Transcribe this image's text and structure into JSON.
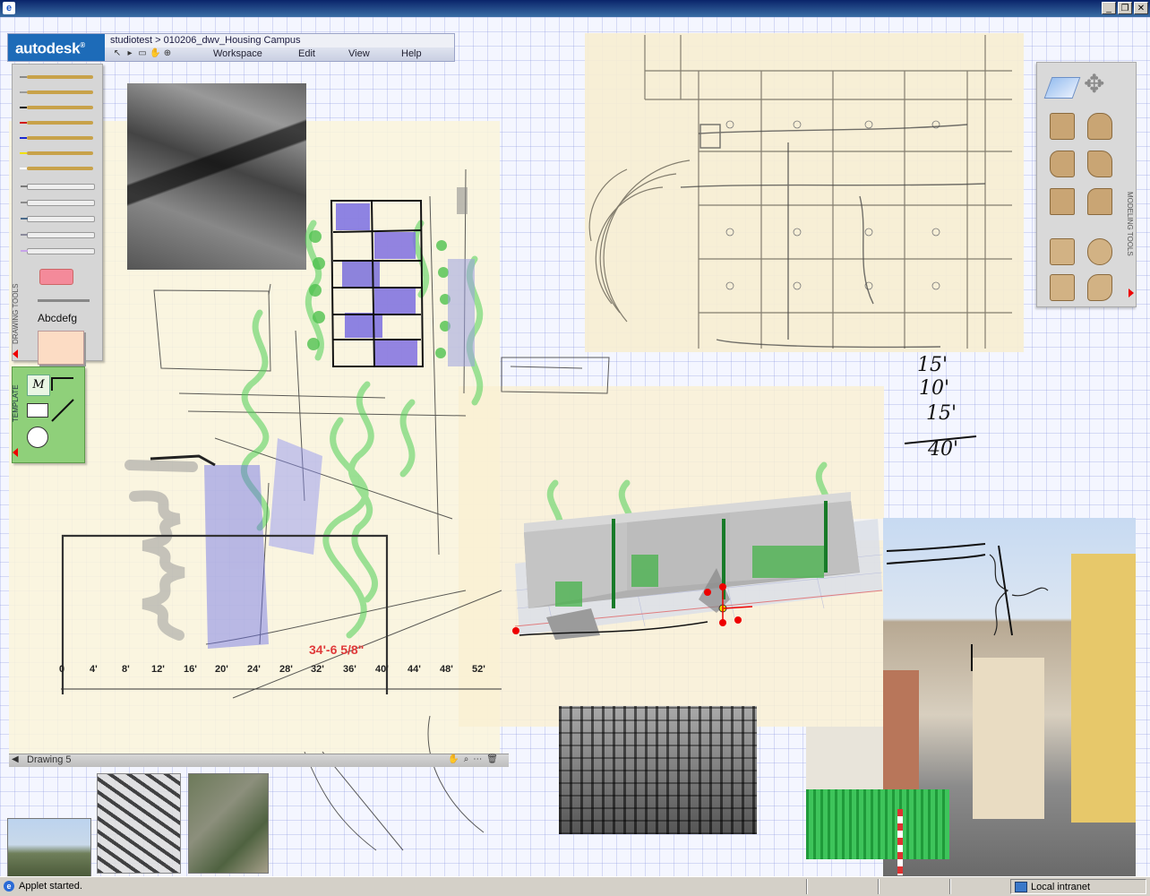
{
  "window": {
    "minimize_glyph": "_",
    "restore_glyph": "❐",
    "close_glyph": "✕"
  },
  "header": {
    "logo": "autodesk",
    "logo_mark": "®",
    "breadcrumb": "studiotest > 010206_dwv_Housing Campus",
    "menus": [
      "Workspace",
      "Edit",
      "View",
      "Help"
    ]
  },
  "drawing_tools": {
    "title": "DRAWING TOOLS",
    "sample_text": "Abcdefg",
    "pen_colors": [
      "#8a8a8a",
      "#9a9a9a",
      "#111111",
      "#d11a1a",
      "#1a2ad1",
      "#f0e000",
      "#ffffff"
    ],
    "marker_colors": [
      "#7a7a7a",
      "#8a8a8a",
      "#4a6a8a",
      "#8a8a9a",
      "#c7a3e8"
    ],
    "swatch_color": "#fcdcc4",
    "eraser_color": "#f48a9a"
  },
  "template": {
    "title": "TEMPLATE"
  },
  "modeling_tools": {
    "title": "MODELING TOOLS"
  },
  "drawing": {
    "label": "Drawing 5",
    "measurement": "34'-6 5/8\"",
    "ruler_ticks": [
      "0",
      "4'",
      "8'",
      "12'",
      "16'",
      "20'",
      "24'",
      "28'",
      "32'",
      "36'",
      "40'",
      "44'",
      "48'",
      "52'"
    ]
  },
  "sketch_notes": [
    "15'",
    "10'",
    "15'",
    "40'"
  ],
  "status": {
    "left": "Applet started.",
    "right": "Local intranet"
  },
  "colors": {
    "title_bar": "#0a246a",
    "accent": "#1d6bb8",
    "measure_red": "#e03a3a",
    "template_green": "#8fd07a"
  }
}
